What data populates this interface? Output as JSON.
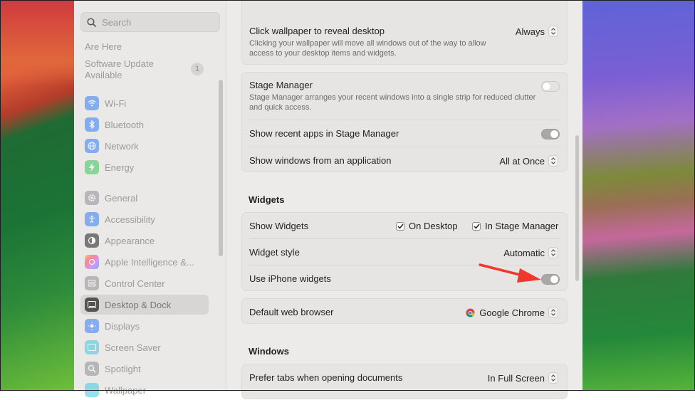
{
  "sidebar": {
    "search_placeholder": "Search",
    "partial_top": "Are Here",
    "software_update": "Software Update Available",
    "software_update_line1": "Software Update",
    "software_update_line2": "Available",
    "badge_count": "1",
    "items": [
      {
        "label": "Wi-Fi",
        "icon": "wifi-icon",
        "color": "#2f7df6"
      },
      {
        "label": "Bluetooth",
        "icon": "bluetooth-icon",
        "color": "#2f7df6"
      },
      {
        "label": "Network",
        "icon": "globe-icon",
        "color": "#2f7df6"
      },
      {
        "label": "Energy",
        "icon": "bolt-icon",
        "color": "#35c759"
      },
      {
        "label": "General",
        "icon": "gear-icon",
        "color": "#8e8e93"
      },
      {
        "label": "Accessibility",
        "icon": "accessibility-icon",
        "color": "#2f7df6"
      },
      {
        "label": "Appearance",
        "icon": "appearance-icon",
        "color": "#1c1c1e"
      },
      {
        "label": "Apple Intelligence &...",
        "icon": "apple-intelligence-icon",
        "color": "#ff6b9a"
      },
      {
        "label": "Control Center",
        "icon": "control-center-icon",
        "color": "#8e8e93"
      },
      {
        "label": "Desktop & Dock",
        "icon": "desktop-dock-icon",
        "color": "#1c1c1e"
      },
      {
        "label": "Displays",
        "icon": "sun-icon",
        "color": "#2f7df6"
      },
      {
        "label": "Screen Saver",
        "icon": "screen-saver-icon",
        "color": "#40c8e0"
      },
      {
        "label": "Spotlight",
        "icon": "magnifier-icon",
        "color": "#8e8e93"
      },
      {
        "label": "Wallpaper",
        "icon": "wallpaper-icon",
        "color": "#40c8e0"
      }
    ]
  },
  "main": {
    "wallpaper_card": {
      "title": "Click wallpaper to reveal desktop",
      "subtitle": "Clicking your wallpaper will move all windows out of the way to allow access to your desktop items and widgets.",
      "value": "Always"
    },
    "stage_manager_card": {
      "title": "Stage Manager",
      "subtitle": "Stage Manager arranges your recent windows into a single strip for reduced clutter and quick access.",
      "recent_apps": "Show recent apps in Stage Manager",
      "show_windows": "Show windows from an application",
      "show_windows_value": "All at Once"
    },
    "widgets_title": "Widgets",
    "widgets_card": {
      "show_widgets": "Show Widgets",
      "on_desktop": "On Desktop",
      "in_stage_manager": "In Stage Manager",
      "widget_style": "Widget style",
      "widget_style_value": "Automatic",
      "iphone_widgets": "Use iPhone widgets"
    },
    "browser_card": {
      "title": "Default web browser",
      "value": "Google Chrome"
    },
    "windows_title": "Windows",
    "windows_card": {
      "prefer_tabs": "Prefer tabs when opening documents",
      "prefer_tabs_value": "In Full Screen"
    }
  },
  "colors": {
    "annotation_arrow": "#f0372e"
  }
}
